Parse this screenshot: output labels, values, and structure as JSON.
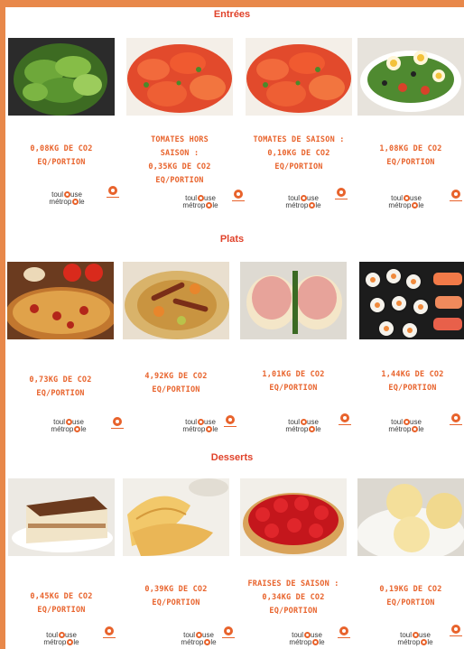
{
  "sections": [
    {
      "title": "Entrées",
      "items": [
        {
          "name": "salade-verte",
          "lines": [
            "0,08KG DE CO2",
            "EQ/PORTION"
          ]
        },
        {
          "name": "tomates-hors-saison",
          "lines": [
            "TOMATES HORS",
            "SAISON :",
            "0,35KG DE CO2",
            "EQ/PORTION"
          ]
        },
        {
          "name": "tomates-de-saison",
          "lines": [
            "TOMATES DE SAISON :",
            "0,10KG DE CO2",
            "EQ/PORTION"
          ]
        },
        {
          "name": "salade-nicoise",
          "lines": [
            "1,08KG DE CO2",
            "EQ/PORTION"
          ]
        }
      ]
    },
    {
      "title": "Plats",
      "items": [
        {
          "name": "pizza",
          "lines": [
            "0,73KG DE CO2",
            "EQ/PORTION"
          ]
        },
        {
          "name": "couscous",
          "lines": [
            "4,92KG DE CO2",
            "EQ/PORTION"
          ]
        },
        {
          "name": "jambon-fromage",
          "lines": [
            "1,01KG DE CO2",
            "EQ/PORTION"
          ]
        },
        {
          "name": "sushis",
          "lines": [
            "1,44KG DE CO2",
            "EQ/PORTION"
          ]
        }
      ]
    },
    {
      "title": "Desserts",
      "items": [
        {
          "name": "tiramisu",
          "lines": [
            "0,45KG DE CO2",
            "EQ/PORTION"
          ]
        },
        {
          "name": "crepes",
          "lines": [
            "0,39KG DE CO2",
            "EQ/PORTION"
          ]
        },
        {
          "name": "tarte-fraises",
          "lines": [
            "FRAISES DE SAISON :",
            "0,34KG DE CO2",
            "EQ/PORTION"
          ]
        },
        {
          "name": "glace-vanille",
          "lines": [
            "0,19KG DE CO2",
            "EQ/PORTION"
          ]
        }
      ]
    }
  ],
  "brand": {
    "line1": "toul",
    "line1b": "use",
    "line2": "métrop",
    "line2b": "le"
  },
  "colors": {
    "accent": "#e8632c",
    "title": "#e0422a",
    "border": "#e8884a"
  }
}
